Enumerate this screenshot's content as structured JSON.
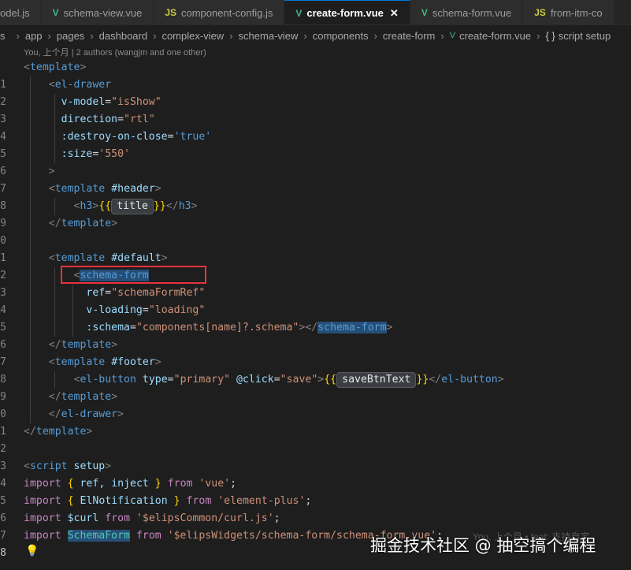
{
  "tabs": [
    {
      "label": "odel.js",
      "type": "js",
      "active": false
    },
    {
      "label": "schema-view.vue",
      "type": "vue",
      "active": false
    },
    {
      "label": "component-config.js",
      "type": "js",
      "active": false
    },
    {
      "label": "create-form.vue",
      "type": "vue",
      "active": true
    },
    {
      "label": "schema-form.vue",
      "type": "vue",
      "active": false
    },
    {
      "label": "from-itm-co",
      "type": "js",
      "active": false
    }
  ],
  "tab_icons": {
    "js": "JS",
    "vue": "V"
  },
  "close_glyph": "✕",
  "breadcrumb": {
    "lead": "s",
    "items": [
      "app",
      "pages",
      "dashboard",
      "complex-view",
      "schema-view",
      "components",
      "create-form",
      "create-form.vue"
    ],
    "symbol": "script setup",
    "symbol_icon": "{ }"
  },
  "blame": "You, 上个月 | 2 authors (wangjm and one other)",
  "colors": {
    "accent": "#0078d4",
    "highlight_box": "#e8323c",
    "editor_bg": "#1e1e1e"
  },
  "lines": {
    "l1": {
      "n": "1"
    },
    "l2": {
      "n": "2"
    },
    "l3": {
      "n": "3",
      "attr": "v-model",
      "val": "\"isShow\""
    },
    "l4": {
      "n": "4",
      "attr": "direction",
      "val": "\"rtl\""
    },
    "l5": {
      "n": "5",
      "attr": ":destroy-on-close",
      "val": "'true'"
    },
    "l6": {
      "n": "6",
      "attr": ":size",
      "val": "'550'"
    },
    "l7": {
      "n": "7"
    },
    "l8": {
      "n": "8",
      "attr": "#header"
    },
    "l9": {
      "n": "9",
      "hint": "title"
    },
    "l10": {
      "n": "0"
    },
    "l11": {
      "n": "1"
    },
    "l12": {
      "n": "2",
      "attr": "#default"
    },
    "l13": {
      "n": "3",
      "tag": "schema-form"
    },
    "l14": {
      "n": "4",
      "attr": "ref",
      "val": "\"schemaFormRef\""
    },
    "l15": {
      "n": "5",
      "attr": "v-loading",
      "val": "\"loading\""
    },
    "l16": {
      "n": "6",
      "attr": ":schema",
      "val": "\"components[name]?.schema\"",
      "close": "schema-form"
    },
    "l17": {
      "n": "7"
    },
    "l18": {
      "n": "8",
      "attr": "#footer"
    },
    "l19": {
      "n": "9",
      "a1": "type",
      "v1": "\"primary\"",
      "a2": "@click",
      "v2": "\"save\"",
      "hint": "saveBtnText"
    },
    "l20": {
      "n": "0"
    },
    "l21": {
      "n": "1"
    },
    "l22": {
      "n": "2"
    },
    "l23": {
      "n": "3"
    },
    "l24": {
      "n": "4",
      "attr": "setup"
    },
    "l25": {
      "n": "5",
      "names": "ref, inject",
      "from": "'vue'"
    },
    "l26": {
      "n": "6",
      "names": "ElNotification",
      "from": "'element-plus'"
    },
    "l27": {
      "n": "7",
      "name": "$curl",
      "from": "'$elipsCommon/curl.js'"
    },
    "l28": {
      "n": "8",
      "name": "SchemaForm",
      "from": "'$elipsWidgets/schema-form/schema-form.vue'"
    }
  },
  "ghost_text": "You, 上个月 • feat: 支持自定",
  "watermark": "掘金技术社区 @ 抽空搞个编程"
}
